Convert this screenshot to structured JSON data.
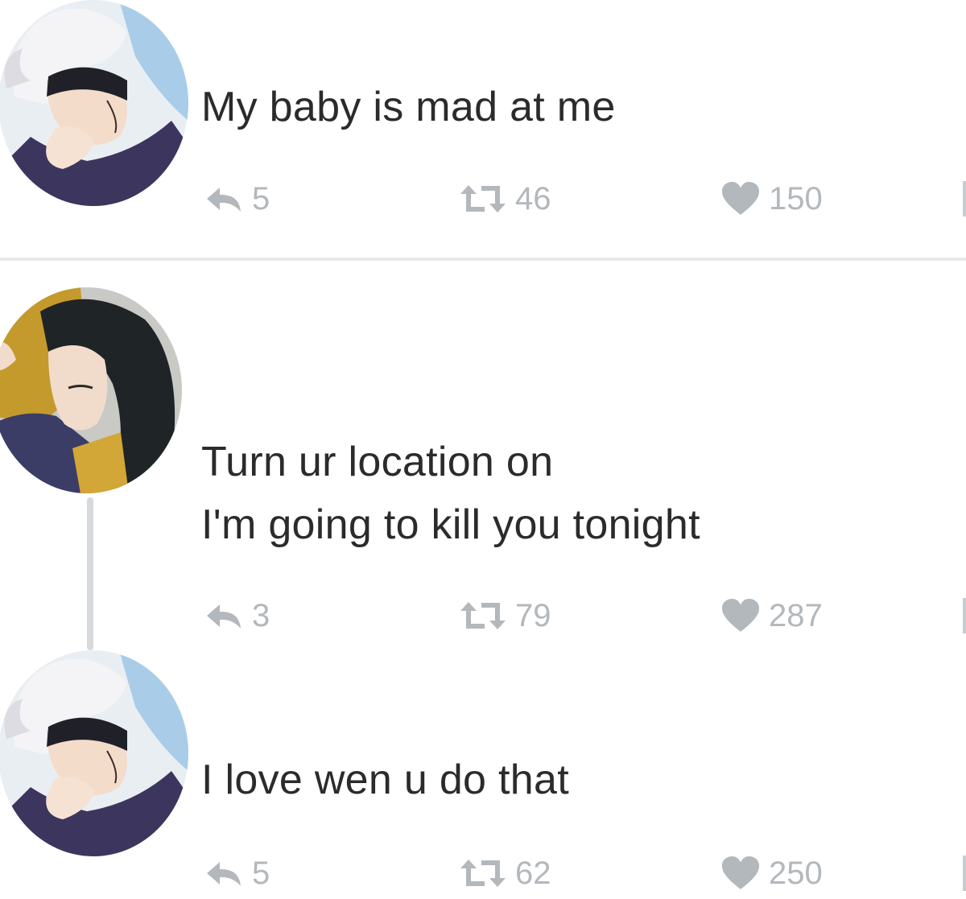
{
  "tweets": [
    {
      "avatar": "white-haired-character-avatar",
      "text": [
        "My baby is mad at me"
      ],
      "replies": "5",
      "retweets": "46",
      "likes": "150"
    },
    {
      "avatar": "black-haired-character-avatar",
      "text": [
        "Turn ur location on",
        "I'm going to kill you tonight"
      ],
      "replies": "3",
      "retweets": "79",
      "likes": "287"
    },
    {
      "avatar": "white-haired-character-avatar",
      "text": [
        "I love wen u do that"
      ],
      "replies": "5",
      "retweets": "62",
      "likes": "250"
    }
  ],
  "colors": {
    "text": "#2b2b2b",
    "icon": "#b3b8bd",
    "divider": "#e6e8ea",
    "thread_line": "#d6dadd"
  },
  "icons": {
    "reply": "reply-icon",
    "retweet": "retweet-icon",
    "like": "heart-icon"
  }
}
